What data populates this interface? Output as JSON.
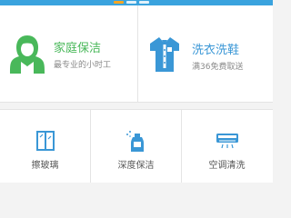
{
  "colors": {
    "header": "#3aa3de",
    "green": "#49b85a",
    "blue": "#3a97d6",
    "subtext": "#8a8a8a"
  },
  "carousel": {
    "active_index": 0,
    "count": 3
  },
  "services_top": [
    {
      "title": "家庭保洁",
      "subtitle": "最专业的小时工",
      "icon": "cleaning-lady-icon"
    },
    {
      "title": "洗衣洗鞋",
      "subtitle": "满36免费取送",
      "icon": "shirt-icon"
    }
  ],
  "services_bottom": [
    {
      "label": "擦玻璃",
      "icon": "window-icon"
    },
    {
      "label": "深度保洁",
      "icon": "spray-bottle-icon"
    },
    {
      "label": "空调清洗",
      "icon": "air-conditioner-icon"
    }
  ]
}
